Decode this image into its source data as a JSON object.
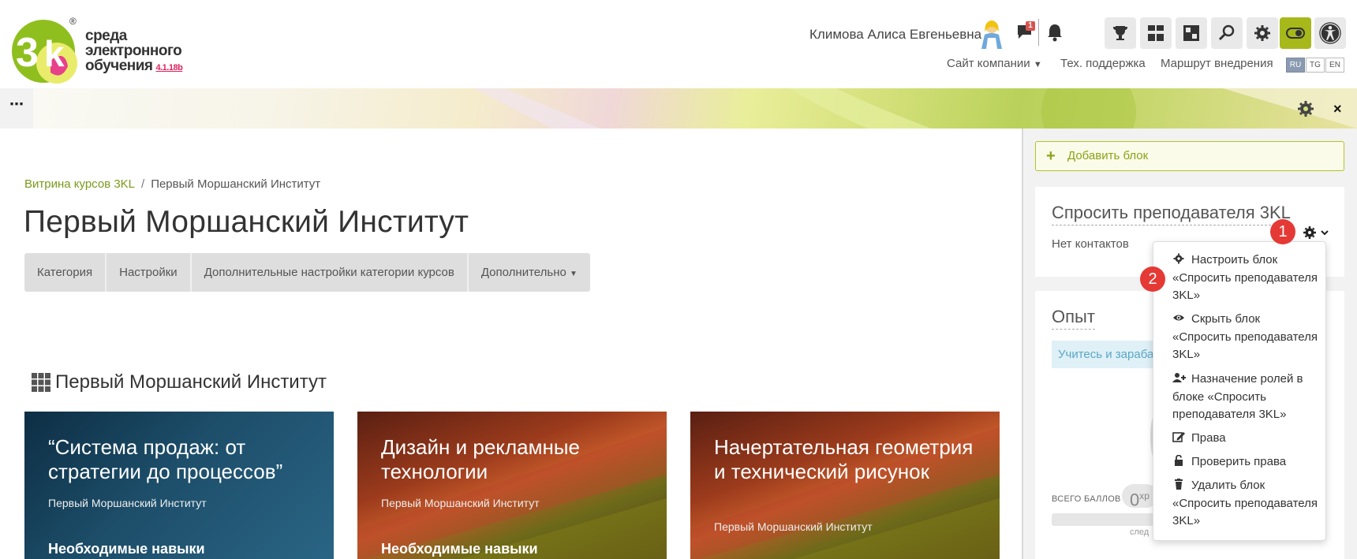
{
  "header": {
    "logo_text_lines": [
      "среда",
      "электронного",
      "обучения"
    ],
    "logo_version": "4.1.18b",
    "logo_reg": "®",
    "user_name": "Климова Алиса Евгеньевна",
    "messages_badge": "1",
    "nav": {
      "company_site": "Сайт компании",
      "support": "Тех. поддержка",
      "route": "Маршрут внедрения"
    },
    "languages": [
      "RU",
      "TG",
      "EN"
    ],
    "selected_language": "RU",
    "tool_icons": [
      "trophy-icon",
      "dashboard-icon",
      "puzzle-icon",
      "search-icon",
      "gear-icon",
      "toggle-icon",
      "accessibility-icon"
    ]
  },
  "banner": {
    "menu_label": "⋯",
    "close_label": "×"
  },
  "breadcrumb": {
    "items": [
      "Витрина курсов 3KL",
      "Первый Моршанский Институт"
    ],
    "separator": "/"
  },
  "page_title": "Первый Моршанский Институт",
  "tabs": [
    "Категория",
    "Настройки",
    "Дополнительные настройки категории курсов",
    "Дополнительно"
  ],
  "section_title": "Первый Моршанский Институт",
  "courses": [
    {
      "title": "“Система продаж: от стратегии до процессов”",
      "category": "Первый Моршанский Институт",
      "skills": "Необходимые навыки"
    },
    {
      "title": "Дизайн и рекламные технологии",
      "category": "Первый Моршанский Институт",
      "skills": "Необходимые навыки"
    },
    {
      "title": "Начертательная геометрия и технический рисунок",
      "category": "Первый Моршанский Институт",
      "skills": ""
    }
  ],
  "sidebar": {
    "add_block": "Добавить блок",
    "ask_block": {
      "title": "Спросить преподавателя 3KL",
      "empty_text": "Нет контактов"
    },
    "xp_block": {
      "title": "Опыт",
      "info_text": "Учитесь и зараба",
      "total_label": "ВСЕГО БАЛЛОВ",
      "xp_value": "0",
      "xp_unit": "xp",
      "next_label": "след"
    }
  },
  "dropdown": {
    "items": [
      {
        "label": "Настроить блок «Спросить преподавателя 3KL»",
        "icon": "gear-icon"
      },
      {
        "label": "Скрыть блок «Спросить преподавателя 3KL»",
        "icon": "eye-icon"
      },
      {
        "label": "Назначение ролей в блоке «Спросить преподавателя 3KL»",
        "icon": "user-plus-icon"
      },
      {
        "label": "Права",
        "icon": "edit-icon"
      },
      {
        "label": "Проверить права",
        "icon": "unlock-icon"
      },
      {
        "label": "Удалить блок «Спросить преподавателя 3KL»",
        "icon": "trash-icon"
      }
    ]
  },
  "annotations": [
    "1",
    "2"
  ],
  "colors": {
    "accent": "#a7b81a",
    "link": "#7a9a1a",
    "step_marker": "#e53935"
  }
}
